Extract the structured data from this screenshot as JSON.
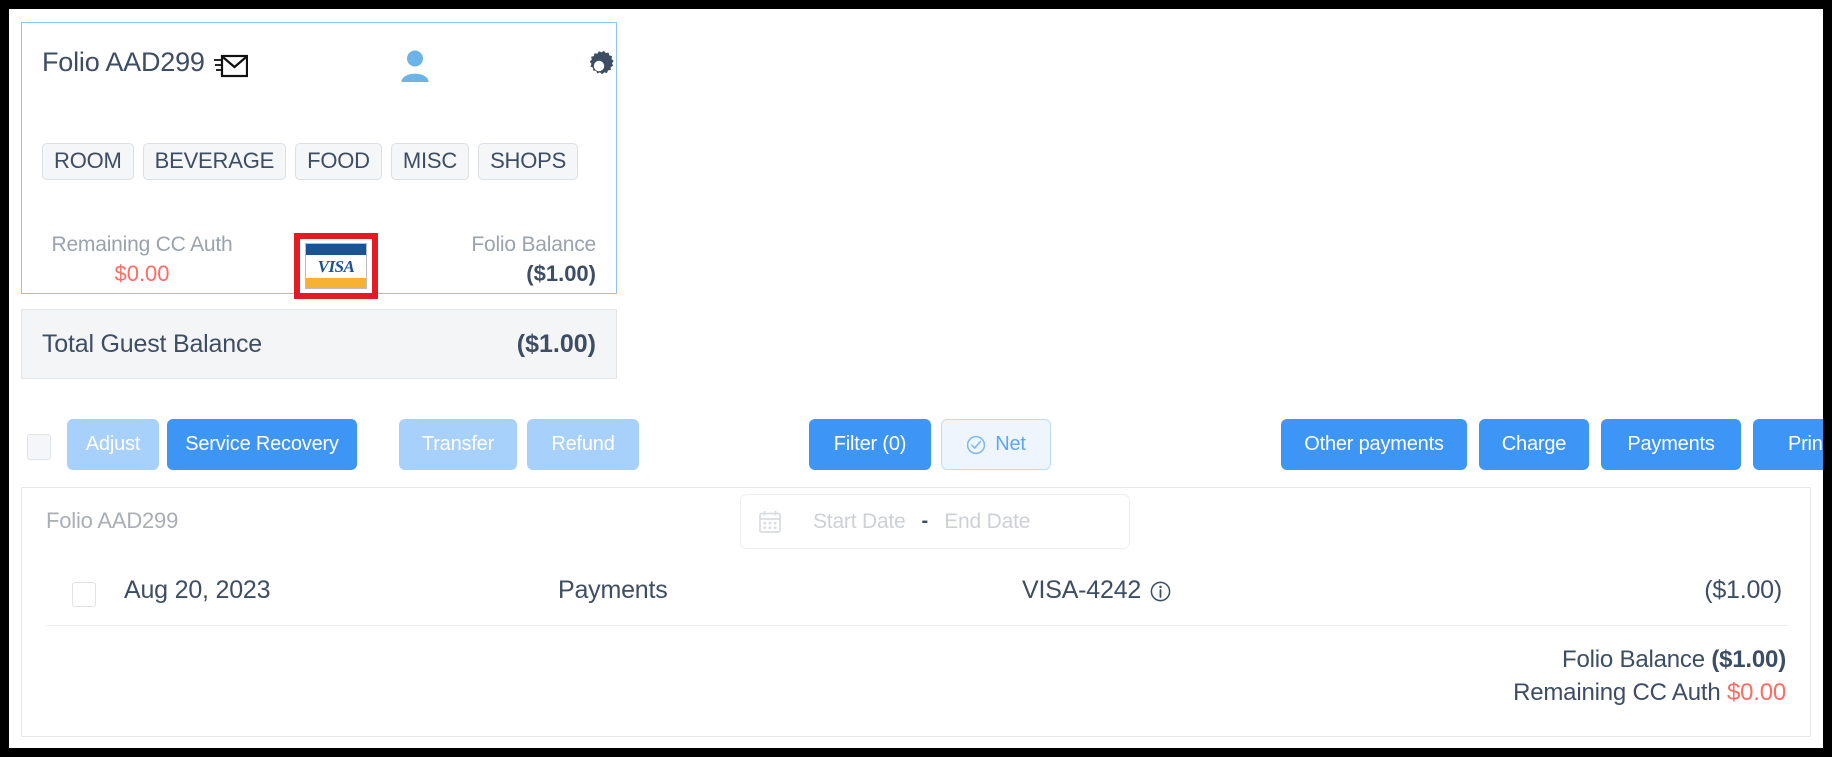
{
  "folio_card": {
    "title": "Folio AAD299",
    "icons": {
      "mail": "envelope-icon",
      "guest": "person-icon",
      "settings": "gear-icon"
    },
    "chips": [
      {
        "label": "ROOM"
      },
      {
        "label": "BEVERAGE"
      },
      {
        "label": "FOOD"
      },
      {
        "label": "MISC"
      },
      {
        "label": "SHOPS"
      }
    ],
    "remaining_cc_auth": {
      "label": "Remaining CC Auth",
      "value": "$0.00",
      "value_color": "#ff6b63"
    },
    "folio_balance": {
      "label": "Folio Balance",
      "value": "($1.00)",
      "value_color": "#3d4d64"
    },
    "payment_method": {
      "brand": "VISA",
      "highlight_color": "#e31b23",
      "band_top_color": "#1a5296",
      "band_bottom_color": "#f5b233"
    }
  },
  "total_guest_balance": {
    "label": "Total Guest Balance",
    "value": "($1.00)"
  },
  "toolbar": {
    "adjust_label": "Adjust",
    "service_recovery_label": "Service Recovery",
    "transfer_label": "Transfer",
    "refund_label": "Refund",
    "filter_label": "Filter (0)",
    "net_label": "Net",
    "other_payments_label": "Other payments",
    "charge_label": "Charge",
    "payments_label": "Payments",
    "print_label": "Print",
    "primary_color": "#3d95f5",
    "disabled_color": "#a7d0fb"
  },
  "transactions_panel": {
    "folio_label": "Folio AAD299",
    "date_range": {
      "start_placeholder": "Start Date",
      "separator": "-",
      "end_placeholder": "End Date",
      "start_value": "",
      "end_value": ""
    },
    "rows": [
      {
        "date": "Aug 20, 2023",
        "type": "Payments",
        "method": "VISA-4242",
        "amount": "($1.00)"
      }
    ],
    "totals": {
      "folio_balance_label": "Folio Balance",
      "folio_balance_value": "($1.00)",
      "remaining_cc_auth_label": "Remaining CC Auth",
      "remaining_cc_auth_value": "$0.00"
    }
  }
}
